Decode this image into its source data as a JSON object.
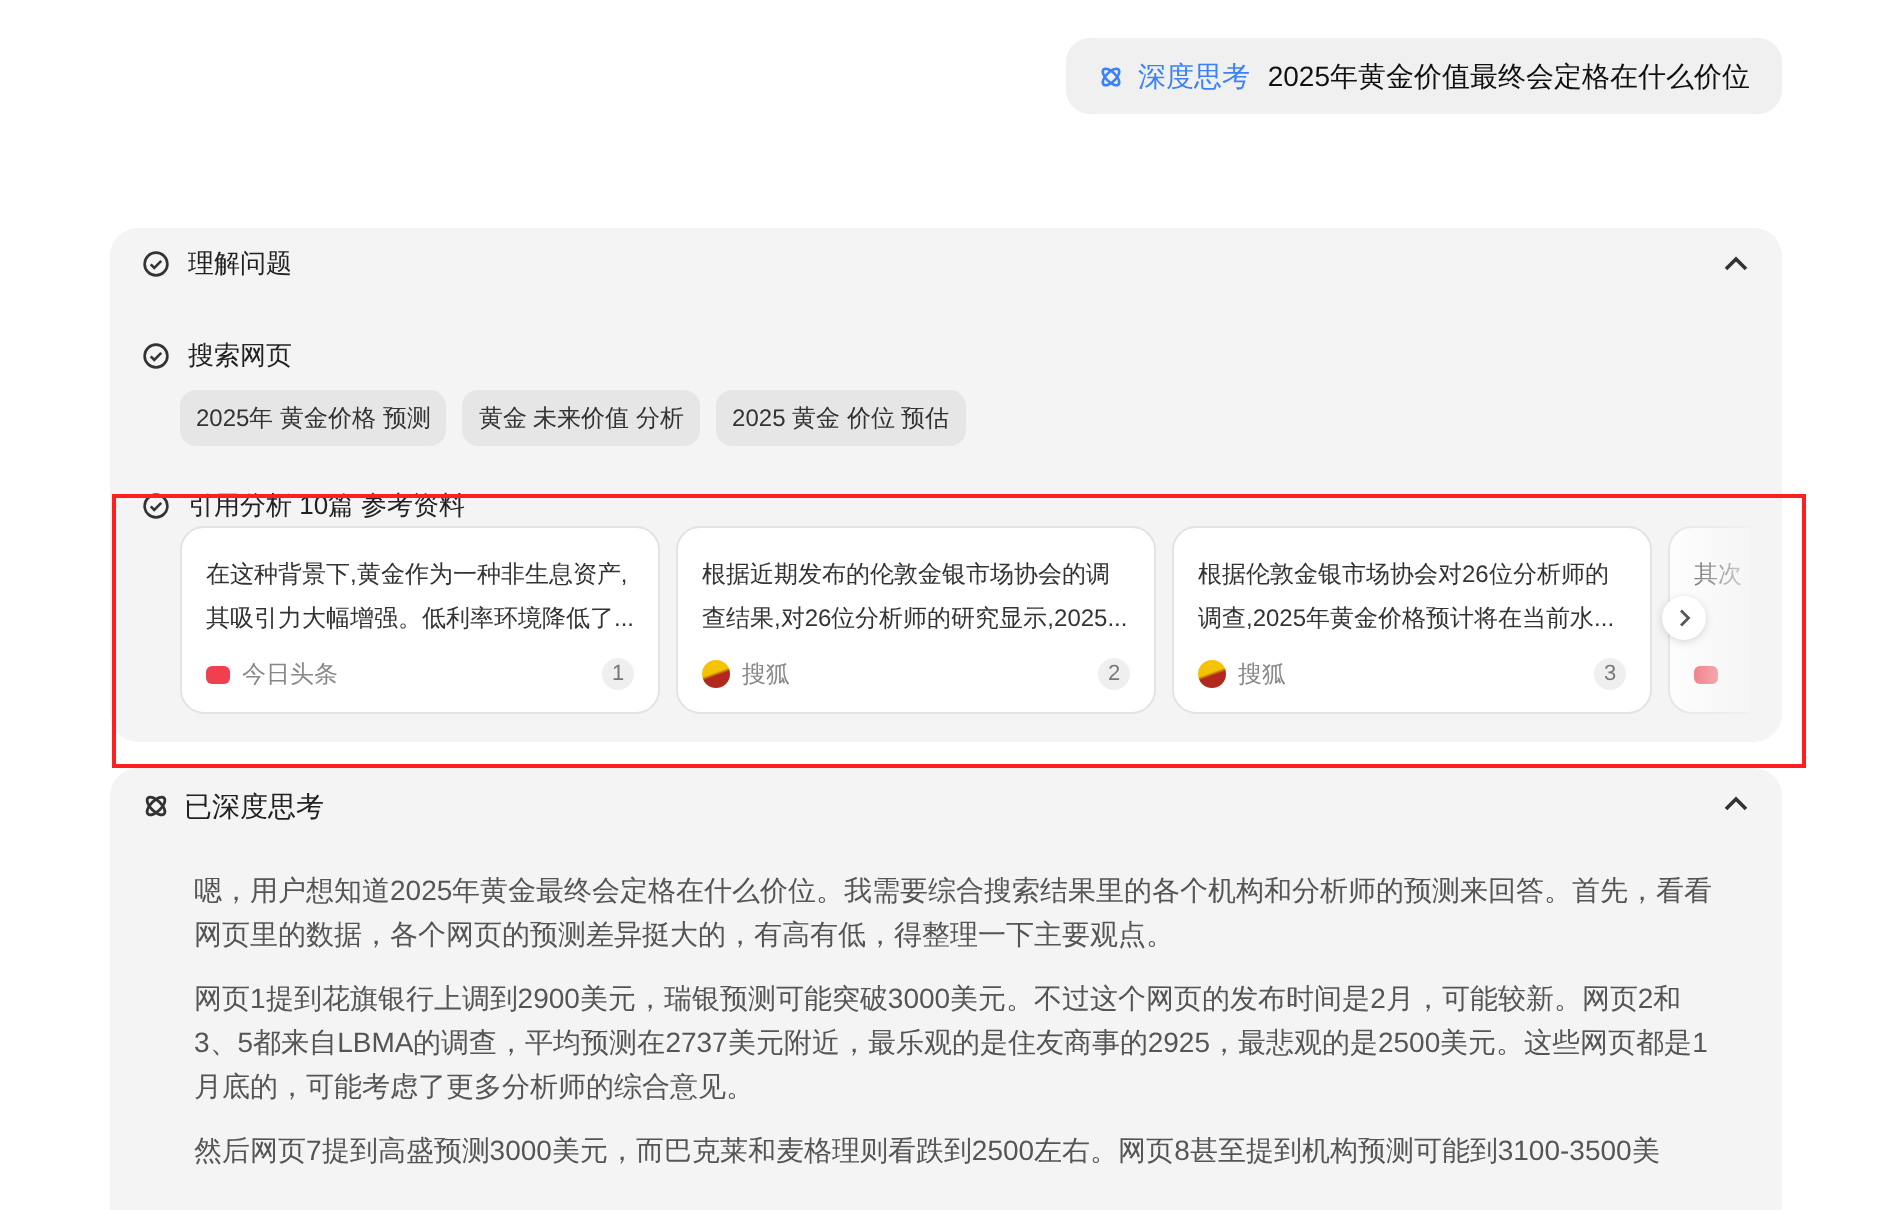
{
  "query": {
    "mode_label": "深度思考",
    "text": "2025年黄金价值最终会定格在什么价位"
  },
  "search_panel": {
    "expanded": true,
    "steps": [
      {
        "kind": "plain",
        "label": "理解问题"
      },
      {
        "kind": "search",
        "label": "搜索网页",
        "keywords": [
          "2025年 黄金价格 预测",
          "黄金 未来价值 分析",
          "2025 黄金 价位 预估"
        ]
      },
      {
        "kind": "references",
        "label": "引用分析 10篇 参考资料",
        "cards": [
          {
            "text": "在这种背景下,黄金作为一种非生息资产,其吸引力大幅增强。低利率环境降低了...",
            "kind": "toutiao",
            "source": "今日头条",
            "index": "1"
          },
          {
            "text": "根据近期发布的伦敦金银市场协会的调查结果,对26位分析师的研究显示,2025...",
            "kind": "sohu",
            "source": "搜狐",
            "index": "2"
          },
          {
            "text": "根据伦敦金银市场协会对26位分析师的调查,2025年黄金价格预计将在当前水...",
            "kind": "sohu",
            "source": "搜狐",
            "index": "3"
          },
          {
            "text": "其次",
            "kind": "toutiao"
          }
        ]
      }
    ]
  },
  "thinking": {
    "title": "已深度思考",
    "expanded": true,
    "paragraphs": [
      "嗯，用户想知道2025年黄金最终会定格在什么价位。我需要综合搜索结果里的各个机构和分析师的预测来回答。首先，看看网页里的数据，各个网页的预测差异挺大的，有高有低，得整理一下主要观点。",
      "网页1提到花旗银行上调到2900美元，瑞银预测可能突破3000美元。不过这个网页的发布时间是2月，可能较新。网页2和3、5都来自LBMA的调查，平均预测在2737美元附近，最乐观的是住友商事的2925，最悲观的是2500美元。这些网页都是1月底的，可能考虑了更多分析师的综合意见。",
      "然后网页7提到高盛预测3000美元，而巴克莱和麦格理则看跌到2500左右。网页8甚至提到机构预测可能到3100-3500美"
    ]
  }
}
